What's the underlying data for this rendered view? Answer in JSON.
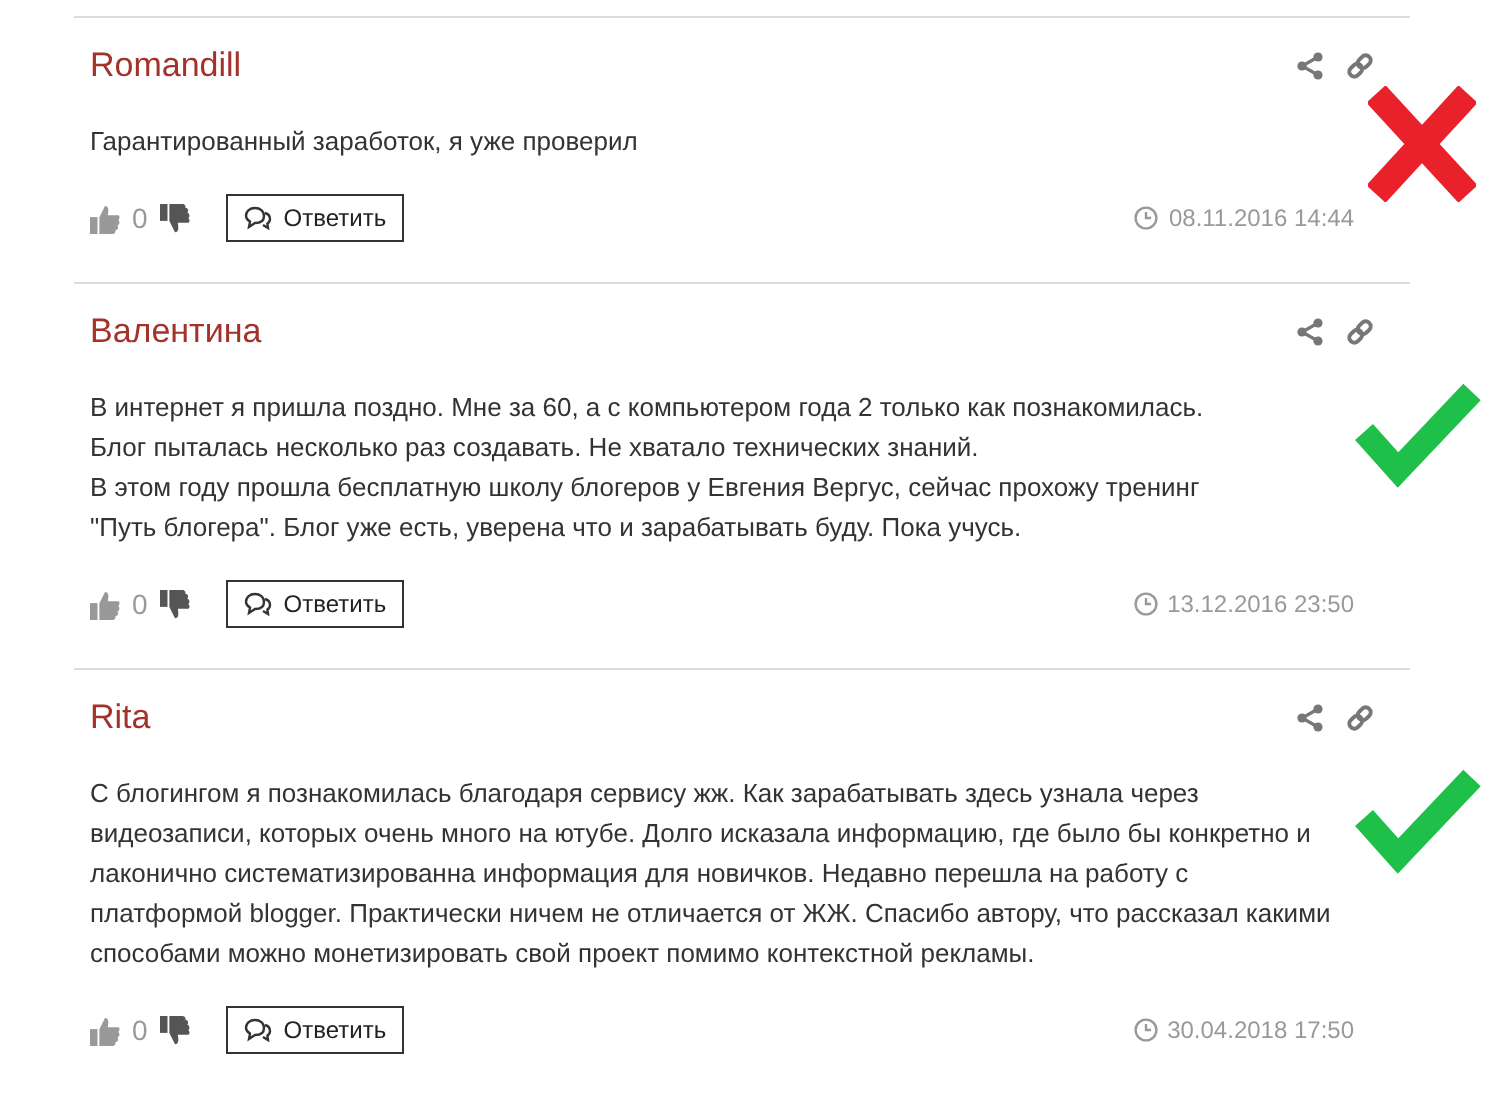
{
  "comments": [
    {
      "author": "Romandill",
      "lines": [
        "Гарантированный заработок, я уже проверил"
      ],
      "likes": "0",
      "reply": "Ответить",
      "date": "08.11.2016 14:44",
      "kind": "cross"
    },
    {
      "author": "Валентина",
      "lines": [
        "В интернет я пришла поздно. Мне за 60, а с компьютером года 2 только как познакомилась.",
        "Блог пыталась несколько раз создавать. Не хватало технических знаний.",
        "В этом году прошла бесплатную школу блогеров у Евгения Вергус, сейчас прохожу тренинг",
        "\"Путь блогера\". Блог уже есть, уверена что и зарабатывать буду. Пока учусь."
      ],
      "likes": "0",
      "reply": "Ответить",
      "date": "13.12.2016 23:50",
      "kind": "check"
    },
    {
      "author": "Rita",
      "lines": [
        "С блогингом я познакомилась благодаря сервису жж. Как зарабатывать здесь узнала через",
        "видеозаписи, которых очень много на ютубе. Долго исказала информацию, где было бы конкретно и",
        "лаконично систематизированна информация для новичков. Недавно перешла на работу с",
        "платформой blogger. Практически ничем не отличается от ЖЖ. Спасибо автору, что рассказал какими",
        "способами можно монетизировать свой проект помимо контекстной рекламы."
      ],
      "likes": "0",
      "reply": "Ответить",
      "date": "30.04.2018 17:50",
      "kind": "check"
    }
  ]
}
